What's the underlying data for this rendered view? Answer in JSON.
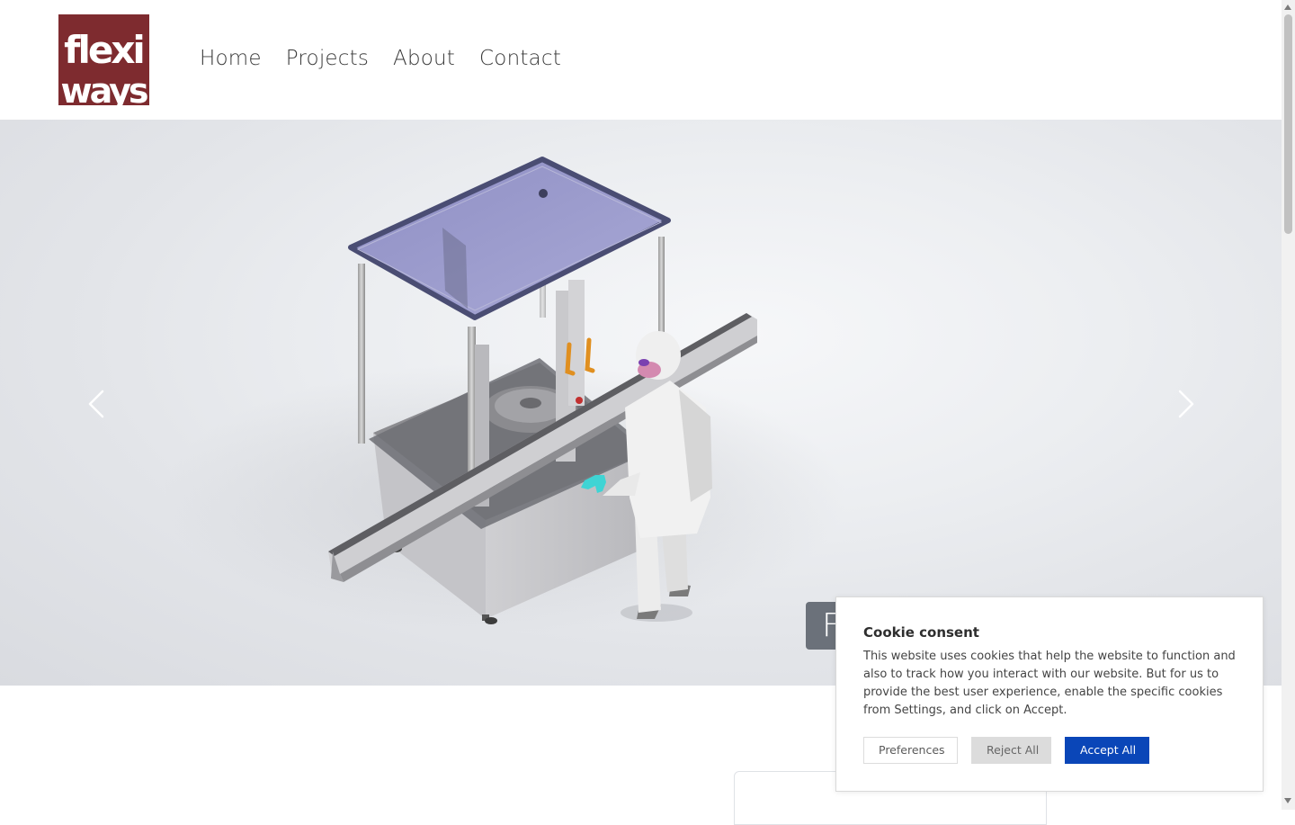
{
  "brand": {
    "logo_line1": "flexi",
    "logo_line2": "ways",
    "logo_color": "#7e2b2f"
  },
  "nav": {
    "items": [
      {
        "label": "Home"
      },
      {
        "label": "Projects"
      },
      {
        "label": "About"
      },
      {
        "label": "Contact"
      }
    ]
  },
  "hero": {
    "caption_text": "F",
    "caption_bg": "#6b717a",
    "prev_icon": "chevron-left-icon",
    "next_icon": "chevron-right-icon"
  },
  "cookie_consent": {
    "title": "Cookie consent",
    "message": "This website uses cookies that help the website to function and also to track how you interact with our website. But for us to provide the best user experience, enable the specific cookies from Settings, and click on Accept.",
    "preferences_label": "Preferences",
    "reject_label": "Reject All",
    "accept_label": "Accept All",
    "accept_color": "#0a46b8"
  }
}
